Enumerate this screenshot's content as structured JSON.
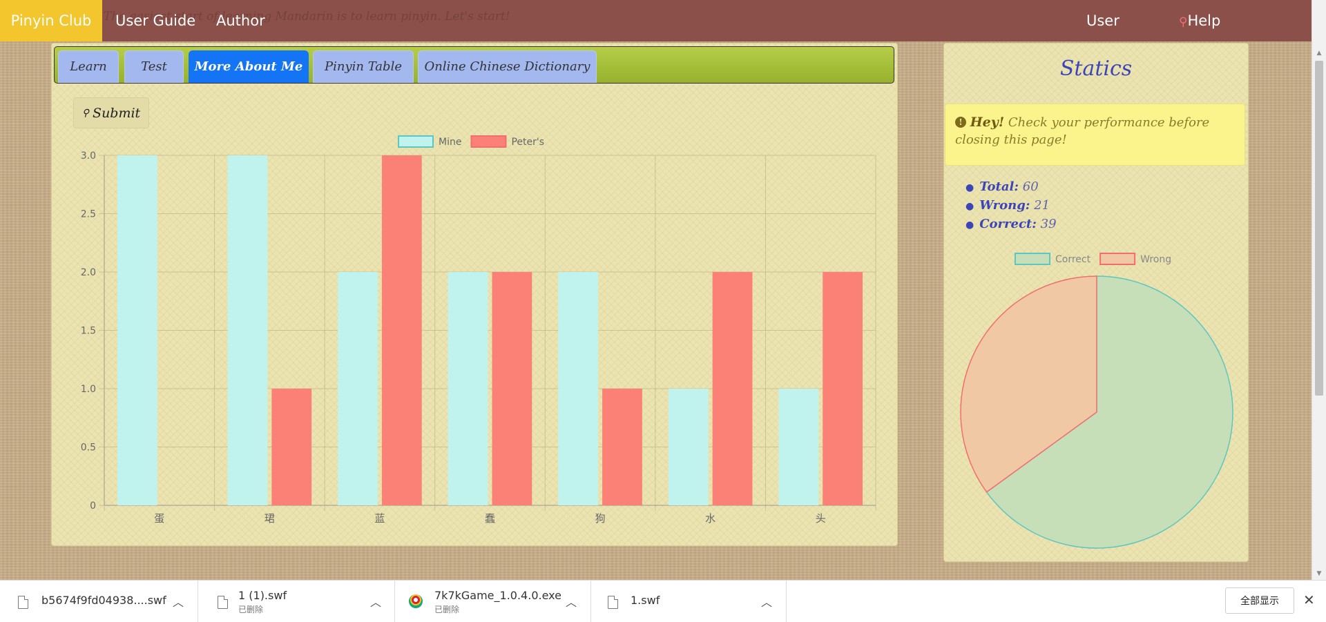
{
  "navbar": {
    "brand": "Pinyin Club",
    "links": [
      "User Guide",
      "Author"
    ],
    "marquee": "The easiest start of learning Mandarin is to learn pinyin. Let's start!",
    "user": "User",
    "help": "Help"
  },
  "tabs": [
    {
      "label": "Learn",
      "active": false
    },
    {
      "label": "Test",
      "active": false
    },
    {
      "label": "More About Me",
      "active": true
    },
    {
      "label": "Pinyin Table",
      "active": false
    },
    {
      "label": "Online Chinese Dictionary",
      "active": false
    }
  ],
  "submit_label": "Submit",
  "colors": {
    "mine": "#c0f3ed",
    "peter": "#fb8177",
    "pie_correct": "#c6dfb8",
    "pie_wrong": "#f0c8a4",
    "pie_correct_border": "#5cc6c0",
    "pie_wrong_border": "#f26d6d",
    "active_tab": "#1474f6",
    "navbar": "#8b5049",
    "brand": "#f2c62c"
  },
  "chart_data": [
    {
      "type": "bar",
      "categories": [
        "蛋",
        "珺",
        "蓝",
        "蠢",
        "狗",
        "水",
        "头"
      ],
      "series": [
        {
          "name": "Mine",
          "values": [
            3,
            3,
            2,
            2,
            2,
            1,
            1
          ]
        },
        {
          "name": "Peter's",
          "values": [
            0,
            1,
            3,
            2,
            1,
            2,
            2
          ]
        }
      ],
      "ylim": [
        0,
        3
      ],
      "yticks": [
        "0",
        "0.5",
        "1.0",
        "1.5",
        "2.0",
        "2.5",
        "3.0"
      ],
      "legend": "top",
      "grid": true
    },
    {
      "type": "pie",
      "labels": [
        "Correct",
        "Wrong"
      ],
      "values": [
        39,
        21
      ],
      "legend": "top"
    }
  ],
  "statics": {
    "title": "Statics",
    "alert_strong": "Hey!",
    "alert_text": "Check your performance before closing this page!",
    "items": [
      {
        "label": "Total:",
        "value": "60"
      },
      {
        "label": "Wrong:",
        "value": "21"
      },
      {
        "label": "Correct:",
        "value": "39"
      }
    ]
  },
  "downloads": [
    {
      "name": "b5674f9fd04938....swf",
      "sub": ""
    },
    {
      "name": "1 (1).swf",
      "sub": "已删除"
    },
    {
      "name": "7k7kGame_1.0.4.0.exe",
      "sub": "已删除"
    },
    {
      "name": "1.swf",
      "sub": ""
    }
  ],
  "show_all": "全部显示"
}
